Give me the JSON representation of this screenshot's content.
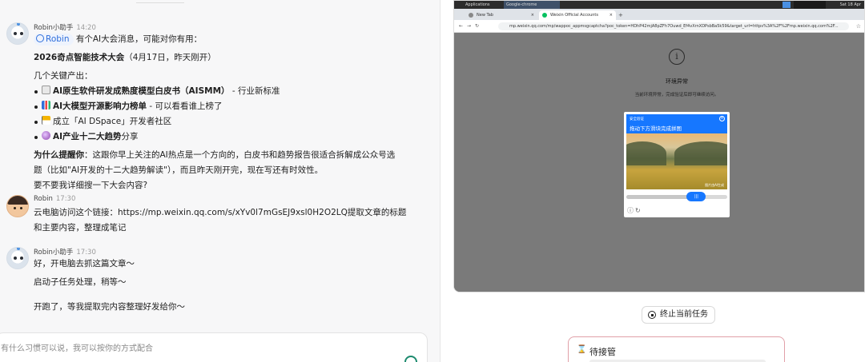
{
  "messages": [
    {
      "sender": "Robin小助手",
      "time": "14:20",
      "mention": "Robin",
      "intro": "有个AI大会消息，可能对你有用：",
      "headline": "2026奇点智能技术大会",
      "headline_note": "（4月17日，昨天刚开）",
      "outputs_label": "几个关键产出：",
      "bullets": [
        {
          "bold": "AI原生软件研发成熟度模型白皮书（AISMM）",
          "rest": " - 行业新标准",
          "emoji": "document-icon"
        },
        {
          "bold": "AI大模型开源影响力榜单",
          "rest": " - 可以看看谁上榜了",
          "emoji": "bar-chart-icon"
        },
        {
          "bold": "",
          "rest": "成立「AI DSpace」开发者社区",
          "emoji": "flag-icon"
        },
        {
          "bold": "AI产业十二大趋势",
          "rest": "分享",
          "emoji": "crystal-ball-icon"
        }
      ],
      "why_bold": "为什么提醒你",
      "why_text_1": "：这跟你早上关注的AI热点是一个方向的，白皮书和趋势报告很适合拆解成公众号选",
      "why_text_2": "题（比如\"AI开发的十二大趋势解读\"），而且昨天刚开完，现在写还有时效性。",
      "question": "要不要我详细搜一下大会内容?"
    },
    {
      "sender": "Robin",
      "time": "17:30",
      "line1": "云电脑访问这个链接：https://mp.weixin.qq.com/s/xYv0l7mGsEJ9xsl0H2O2LQ提取文章的标题",
      "line2": "和主要内容，整理成笔记"
    },
    {
      "sender": "Robin小助手",
      "time": "17:30",
      "line1": "好，开电脑去抓这篇文章～",
      "line2": "启动子任务处理，稍等～",
      "line3": "开跑了，等我提取完内容整理好发给你～"
    }
  ],
  "composer": {
    "placeholder": "有什么习惯可以说，我可以按你的方式配合"
  },
  "remote": {
    "os_app": "Applications",
    "os_window": "Google-chrome",
    "os_clock": "Sat 18 Apr",
    "tabs": [
      {
        "label": "New Tab",
        "active": false,
        "color": "#888888"
      },
      {
        "label": "Weixin Official Accounts",
        "active": true,
        "color": "#07c160"
      }
    ],
    "url": "mp.weixin.qq.com/mp/wappoc_appmsgcaptcha?poc_token=HDhP42mjA8pZFh7Ouwd_Ef4vXrnXDPsbBa5k59&target_url=https%3A%2F%2Fmp.weixin.qq.com%2F...",
    "env_title": "环境异常",
    "env_sub": "当前环境异常，完成验证后即可继续访问。",
    "captcha_l1": "安全验证",
    "captcha_l2": "拖动下方滑块完成拼图",
    "captcha_note": "图片由AI生成",
    "slider_progress": 0.74
  },
  "stop_task": "终止当前任务",
  "pending_title": "待接管"
}
